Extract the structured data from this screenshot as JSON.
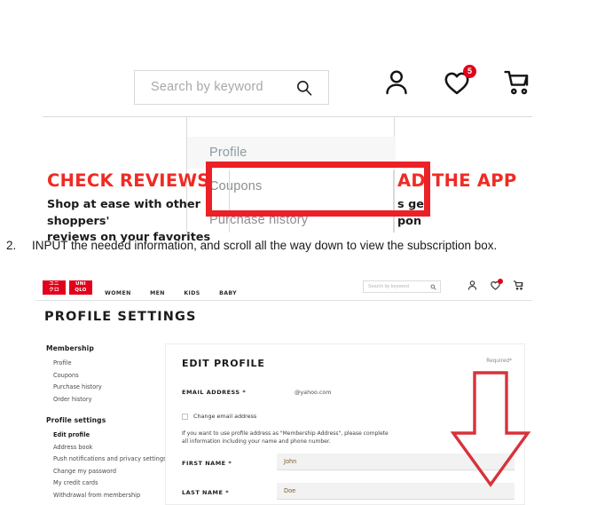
{
  "top_screenshot": {
    "search": {
      "placeholder": "Search by keyword",
      "icon": "search-icon"
    },
    "header_icons": [
      {
        "name": "user-account-icon",
        "label": "Account"
      },
      {
        "name": "wishlist-heart-icon",
        "label": "Wishlist",
        "badge": "5"
      },
      {
        "name": "shopping-cart-icon",
        "label": "Cart"
      }
    ],
    "dropdown": {
      "items": [
        {
          "label": "Profile",
          "selected": true
        },
        {
          "label": "Coupons",
          "selected": false
        },
        {
          "label": "Purchase history",
          "selected": false
        }
      ]
    },
    "banner_left": {
      "title": "CHECK REVIEWS",
      "line1": "Shop at ease with other shoppers'",
      "line2": "reviews on your favorites"
    },
    "banner_right": {
      "title": "AD THE APP",
      "line1": "s get",
      "line2": "pon"
    },
    "highlight_color": "#ec2027"
  },
  "instruction": {
    "number": "2.",
    "text": "INPUT the needed information, and scroll all the way down to view the subscription box."
  },
  "bottom_screenshot": {
    "logo": {
      "mark": "ユニ\nクロ",
      "wordmark_line1": "UNI",
      "wordmark_line2": "QLO",
      "color": "#e2001a"
    },
    "nav": [
      "WOMEN",
      "MEN",
      "KIDS",
      "BABY"
    ],
    "search": {
      "placeholder": "Search by keyword",
      "icon": "search-icon"
    },
    "header_icons": [
      {
        "name": "user-account-icon",
        "label": "Account"
      },
      {
        "name": "wishlist-heart-icon",
        "label": "Wishlist",
        "badge": ""
      },
      {
        "name": "shopping-cart-icon",
        "label": "Cart"
      }
    ],
    "page_title": "PROFILE SETTINGS",
    "sidebar": {
      "group1_title": "Membership",
      "group1_items": [
        "Profile",
        "Coupons",
        "Purchase history",
        "Order history"
      ],
      "group2_title": "Profile settings",
      "group2_items": [
        "Edit profile",
        "Address book",
        "Push notifications and privacy settings",
        "Change my password",
        "My credit cards",
        "Withdrawal from membership"
      ],
      "active_item": "Edit profile"
    },
    "form": {
      "title": "EDIT PROFILE",
      "required_note": "Required*",
      "email_label": "EMAIL ADDRESS *",
      "email_value": "@yahoo.com",
      "change_email_label": "Change email address",
      "change_email_checked": false,
      "note_line1": "If you want to use profile address as \"Membership Address\", please complete",
      "note_line2": "all information including your name and phone number.",
      "first_name_label": "FIRST NAME *",
      "first_name_value": "John",
      "last_name_label": "LAST NAME *",
      "last_name_value": "Doe"
    },
    "arrow": {
      "name": "scroll-down-arrow",
      "color": "#d8323a"
    }
  }
}
